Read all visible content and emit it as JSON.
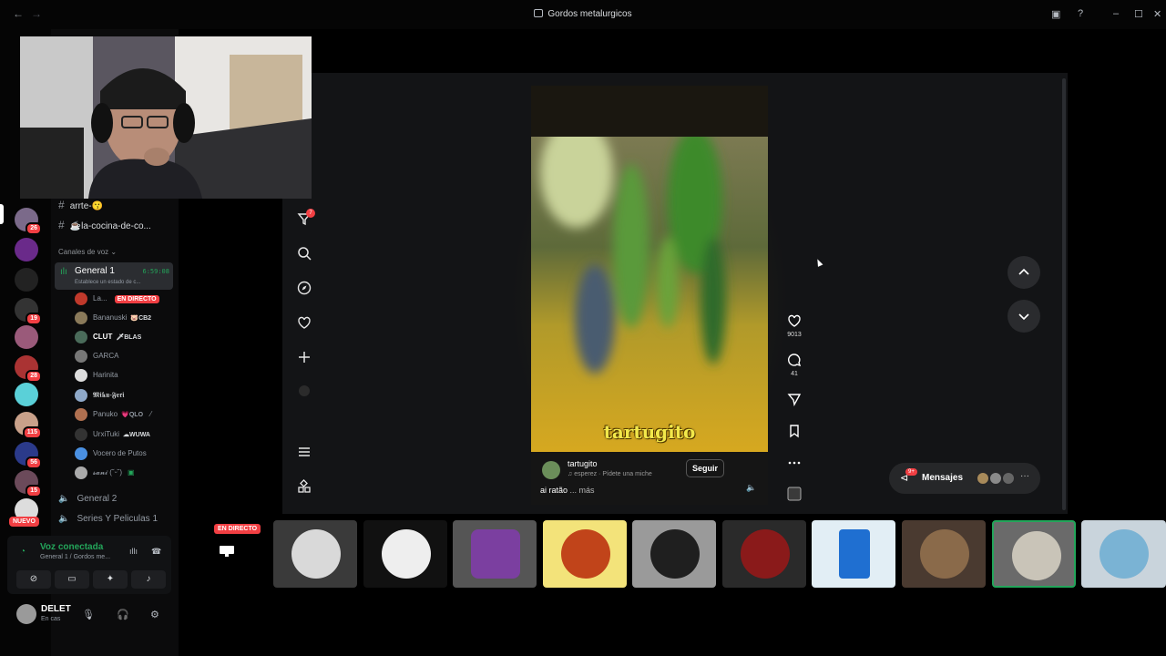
{
  "window": {
    "title": "Gordos metalurgicos"
  },
  "rail": {
    "badges": [
      "26",
      "19",
      "28",
      "115",
      "56",
      "15"
    ],
    "nuevo_label": "NUEVO"
  },
  "channels": {
    "text": [
      {
        "name": "arrte-😗"
      },
      {
        "name": "☕la-cocina-de-co..."
      }
    ],
    "voice_category": "Canales de voz",
    "active_voice": {
      "name": "General 1",
      "time": "6:59:08",
      "status": "Establece un estado de c..."
    },
    "voice_users": [
      {
        "name": "La...",
        "live": "EN DIRECTO",
        "color": "#c0392b"
      },
      {
        "name": "Bananuski",
        "tag": "🐷CB2",
        "color": "#8a7a5a"
      },
      {
        "name": "CLUT",
        "tag": "🗡BLAS",
        "color": "#4a6b5a"
      },
      {
        "name": "GARCA",
        "color": "#777777"
      },
      {
        "name": "Harinita",
        "color": "#dddddd"
      },
      {
        "name": "𝕸𝖎𝖐𝖚-𝕱𝖊𝖗𝖎",
        "color": "#8fa9c9"
      },
      {
        "name": "Panuko",
        "tag": "💗QLO",
        "color": "#b07050"
      },
      {
        "name": "UrxiTuki",
        "tag": "☁WUWA",
        "color": "#333333"
      },
      {
        "name": "Vocero de Putos",
        "color": "#4a90e2"
      },
      {
        "name": "𝓼𝓪𝓷𝓲 (˘ᵕ˘)",
        "color": "#aaaaaa"
      }
    ],
    "other_voice": [
      "General 2",
      "Series Y Peliculas 1"
    ]
  },
  "voice_connection": {
    "title": "Voz conectada",
    "subtitle": "General 1 / Gordos me..."
  },
  "user": {
    "name": "DELET",
    "status": "En cas"
  },
  "tiktok": {
    "notif_count": "7",
    "caption": "tartugito",
    "username": "tartugito",
    "music": "esperez · Pídete una miche",
    "follow_label": "Seguir",
    "description": "ai ratão",
    "more_label": "... más",
    "likes": "9013",
    "comments": "41",
    "messages_label": "Mensajes",
    "messages_badge": "9+"
  },
  "tiles": {
    "live_label": "EN DIRECTO"
  },
  "colors": {
    "accent_green": "#23a55a",
    "badge_red": "#f23f43",
    "caption_yellow": "#f2e84a"
  }
}
